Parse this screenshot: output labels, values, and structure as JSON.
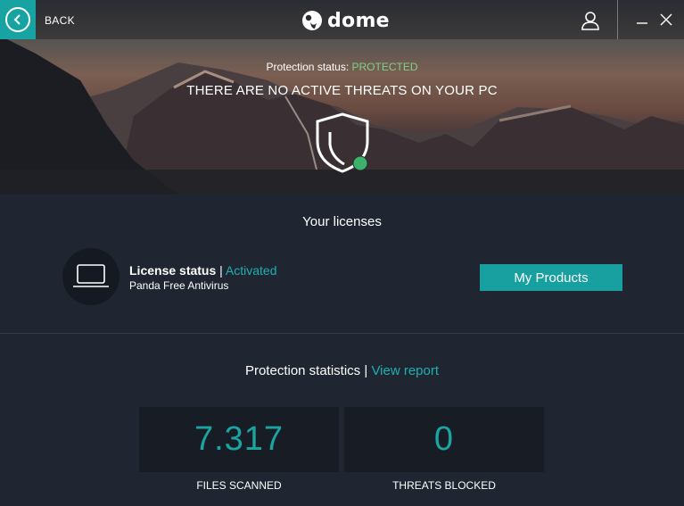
{
  "titlebar": {
    "back_label": "BACK",
    "logo_text": "dome"
  },
  "hero": {
    "status_label": "Protection status:",
    "status_value": "PROTECTED",
    "headline": "THERE ARE NO ACTIVE THREATS ON YOUR PC"
  },
  "licenses": {
    "title": "Your licenses",
    "status_label": "License status",
    "separator": "|",
    "status_value": "Activated",
    "product": "Panda Free Antivirus",
    "button_label": "My Products"
  },
  "statistics": {
    "title": "Protection statistics",
    "separator": "|",
    "link_label": "View report",
    "files_scanned": {
      "value": "7.317",
      "label": "FILES SCANNED"
    },
    "threats_blocked": {
      "value": "0",
      "label": "THREATS BLOCKED"
    }
  },
  "colors": {
    "accent": "#16a3a1",
    "protected_green": "#7ed08a",
    "background": "#1f2631",
    "stat_box": "#181d25"
  },
  "icons": {
    "back": "chevron-left-circle-icon",
    "user": "user-icon",
    "minimize": "minimize-icon",
    "close": "close-icon",
    "shield": "shield-check-icon",
    "device": "laptop-icon"
  }
}
